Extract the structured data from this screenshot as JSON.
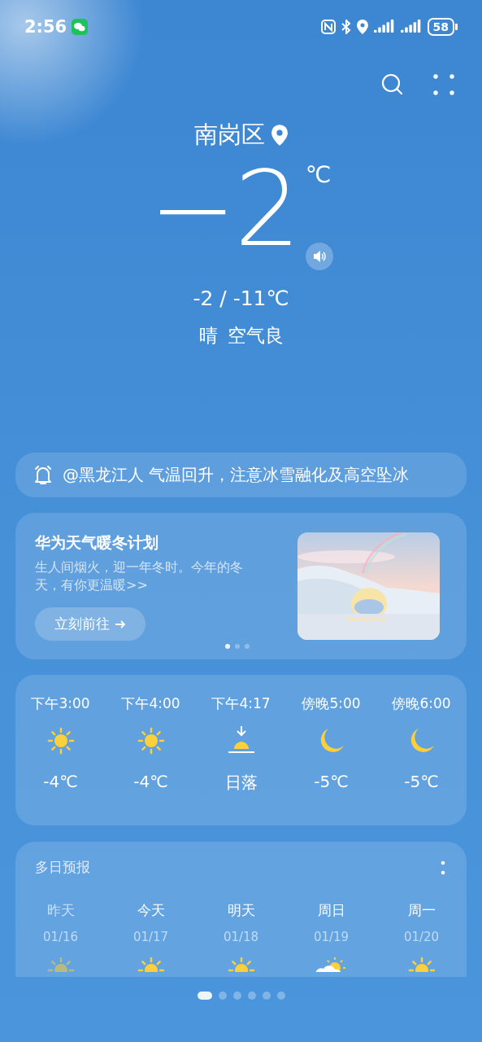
{
  "status_bar": {
    "time": "2:56",
    "battery": "58"
  },
  "location": "南岗区",
  "current": {
    "temperature": "−2",
    "unit": "℃",
    "range": "-2 / -11℃",
    "condition": "晴",
    "air_quality": "空气良"
  },
  "alert": {
    "text": "@黑龙江人 气温回升，注意冰雪融化及高空坠冰"
  },
  "promo": {
    "title": "华为天气暖冬计划",
    "text": "生人间烟火，迎一年冬时。今年的冬天，有你更温暖>>",
    "button": "立刻前往",
    "pager": [
      {
        "selected": true
      },
      {
        "selected": false
      },
      {
        "selected": false
      }
    ]
  },
  "hourly": [
    {
      "time": "下午3:00",
      "kind": "sun",
      "value": "-4℃"
    },
    {
      "time": "下午4:00",
      "kind": "sun",
      "value": "-4℃"
    },
    {
      "time": "下午4:17",
      "kind": "sunset",
      "value": "日落"
    },
    {
      "time": "傍晚5:00",
      "kind": "moon",
      "value": "-5℃"
    },
    {
      "time": "傍晚6:00",
      "kind": "moon",
      "value": "-5℃"
    }
  ],
  "daily": {
    "title": "多日预报",
    "days": [
      {
        "label": "昨天",
        "date": "01/16",
        "kind": "sun",
        "past": true
      },
      {
        "label": "今天",
        "date": "01/17",
        "kind": "sun",
        "past": false
      },
      {
        "label": "明天",
        "date": "01/18",
        "kind": "sun",
        "past": false
      },
      {
        "label": "周日",
        "date": "01/19",
        "kind": "partly_cloudy",
        "past": false
      },
      {
        "label": "周一",
        "date": "01/20",
        "kind": "sun",
        "past": false
      }
    ]
  },
  "pages": [
    {
      "selected": true
    },
    {
      "selected": false
    },
    {
      "selected": false
    },
    {
      "selected": false
    },
    {
      "selected": false
    },
    {
      "selected": false
    }
  ]
}
